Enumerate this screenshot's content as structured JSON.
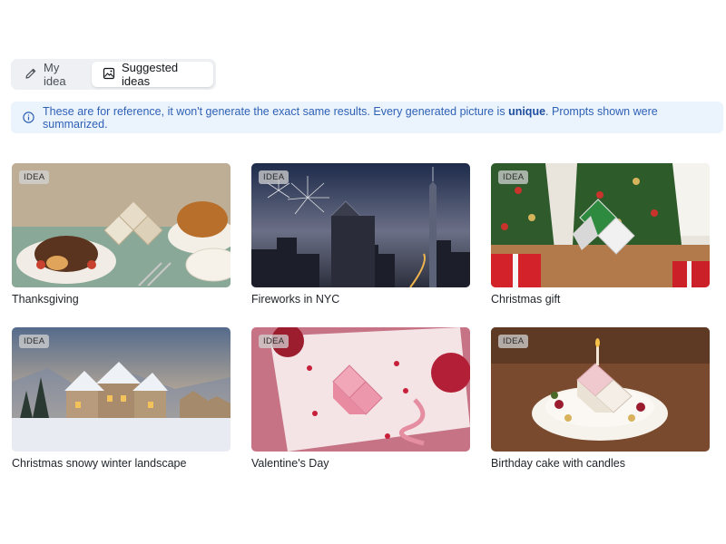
{
  "tabs": [
    {
      "label": "My idea",
      "icon": "pencil-icon",
      "active": false
    },
    {
      "label": "Suggested ideas",
      "icon": "image-icon",
      "active": true
    }
  ],
  "banner": {
    "icon": "info-icon",
    "text_before": "These are for reference, it won't generate the exact same results. Every generated picture is ",
    "emphasis": "unique",
    "text_after": ". Prompts shown were summarized."
  },
  "ideas": [
    {
      "badge": "IDEA",
      "caption": "Thanksgiving"
    },
    {
      "badge": "IDEA",
      "caption": "Fireworks in NYC"
    },
    {
      "badge": "IDEA",
      "caption": "Christmas gift"
    },
    {
      "badge": "IDEA",
      "caption": "Christmas snowy winter landscape"
    },
    {
      "badge": "IDEA",
      "caption": "Valentine's Day"
    },
    {
      "badge": "IDEA",
      "caption": "Birthday cake with candles"
    }
  ],
  "colors": {
    "banner_bg": "#ebf3fd",
    "banner_text": "#2f62b5",
    "tab_bg": "#eef0f3"
  }
}
